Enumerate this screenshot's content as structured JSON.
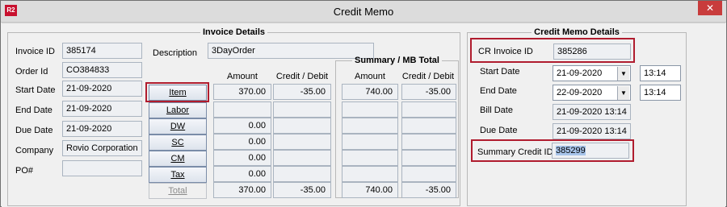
{
  "window": {
    "title": "Credit Memo",
    "icon_text": "R2",
    "close_glyph": "✕"
  },
  "invoice_details": {
    "legend": "Invoice Details",
    "fields": [
      {
        "label": "Invoice ID",
        "value": "385174"
      },
      {
        "label": "Order Id",
        "value": "CO384833"
      },
      {
        "label": "Start Date",
        "value": "21-09-2020"
      },
      {
        "label": "End  Date",
        "value": "21-09-2020"
      },
      {
        "label": "Due Date",
        "value": "21-09-2020"
      },
      {
        "label": "Company",
        "value": "Rovio Corporation"
      },
      {
        "label": "PO#",
        "value": ""
      }
    ],
    "description_label": "Description",
    "description_value": "3DayOrder",
    "col_amount": "Amount",
    "col_credit_debit": "Credit / Debit",
    "summary_legend": "Summary / MB Total",
    "summary_amount": "Amount",
    "summary_credit_debit": "Credit / Debit",
    "rows": [
      {
        "button": "Item",
        "amount": "370.00",
        "credit": "-35.00",
        "s_amount": "740.00",
        "s_credit": "-35.00"
      },
      {
        "button": "Labor",
        "amount": "",
        "credit": "",
        "s_amount": "",
        "s_credit": ""
      },
      {
        "button": "DW",
        "amount": "0.00",
        "credit": "",
        "s_amount": "",
        "s_credit": ""
      },
      {
        "button": "SC",
        "amount": "0.00",
        "credit": "",
        "s_amount": "",
        "s_credit": ""
      },
      {
        "button": "CM",
        "amount": "0.00",
        "credit": "",
        "s_amount": "",
        "s_credit": ""
      },
      {
        "button": "Tax",
        "amount": "0.00",
        "credit": "",
        "s_amount": "",
        "s_credit": ""
      },
      {
        "button": "Total",
        "amount": "370.00",
        "credit": "-35.00",
        "s_amount": "740.00",
        "s_credit": "-35.00"
      }
    ]
  },
  "credit_memo_details": {
    "legend": "Credit Memo Details",
    "cr_invoice_label": "CR Invoice ID",
    "cr_invoice_value": "385286",
    "start_date_label": "Start Date",
    "start_date_value": "21-09-2020",
    "start_time_value": "13:14",
    "end_date_label": "End Date",
    "end_date_value": "22-09-2020",
    "end_time_value": "13:14",
    "bill_date_label": "Bill Date",
    "bill_date_value": "21-09-2020 13:14",
    "due_date_label": "Due Date",
    "due_date_value": "21-09-2020 13:14",
    "summary_credit_label": "Summary Credit ID",
    "summary_credit_value": "385299",
    "dropdown_glyph": "▼"
  }
}
